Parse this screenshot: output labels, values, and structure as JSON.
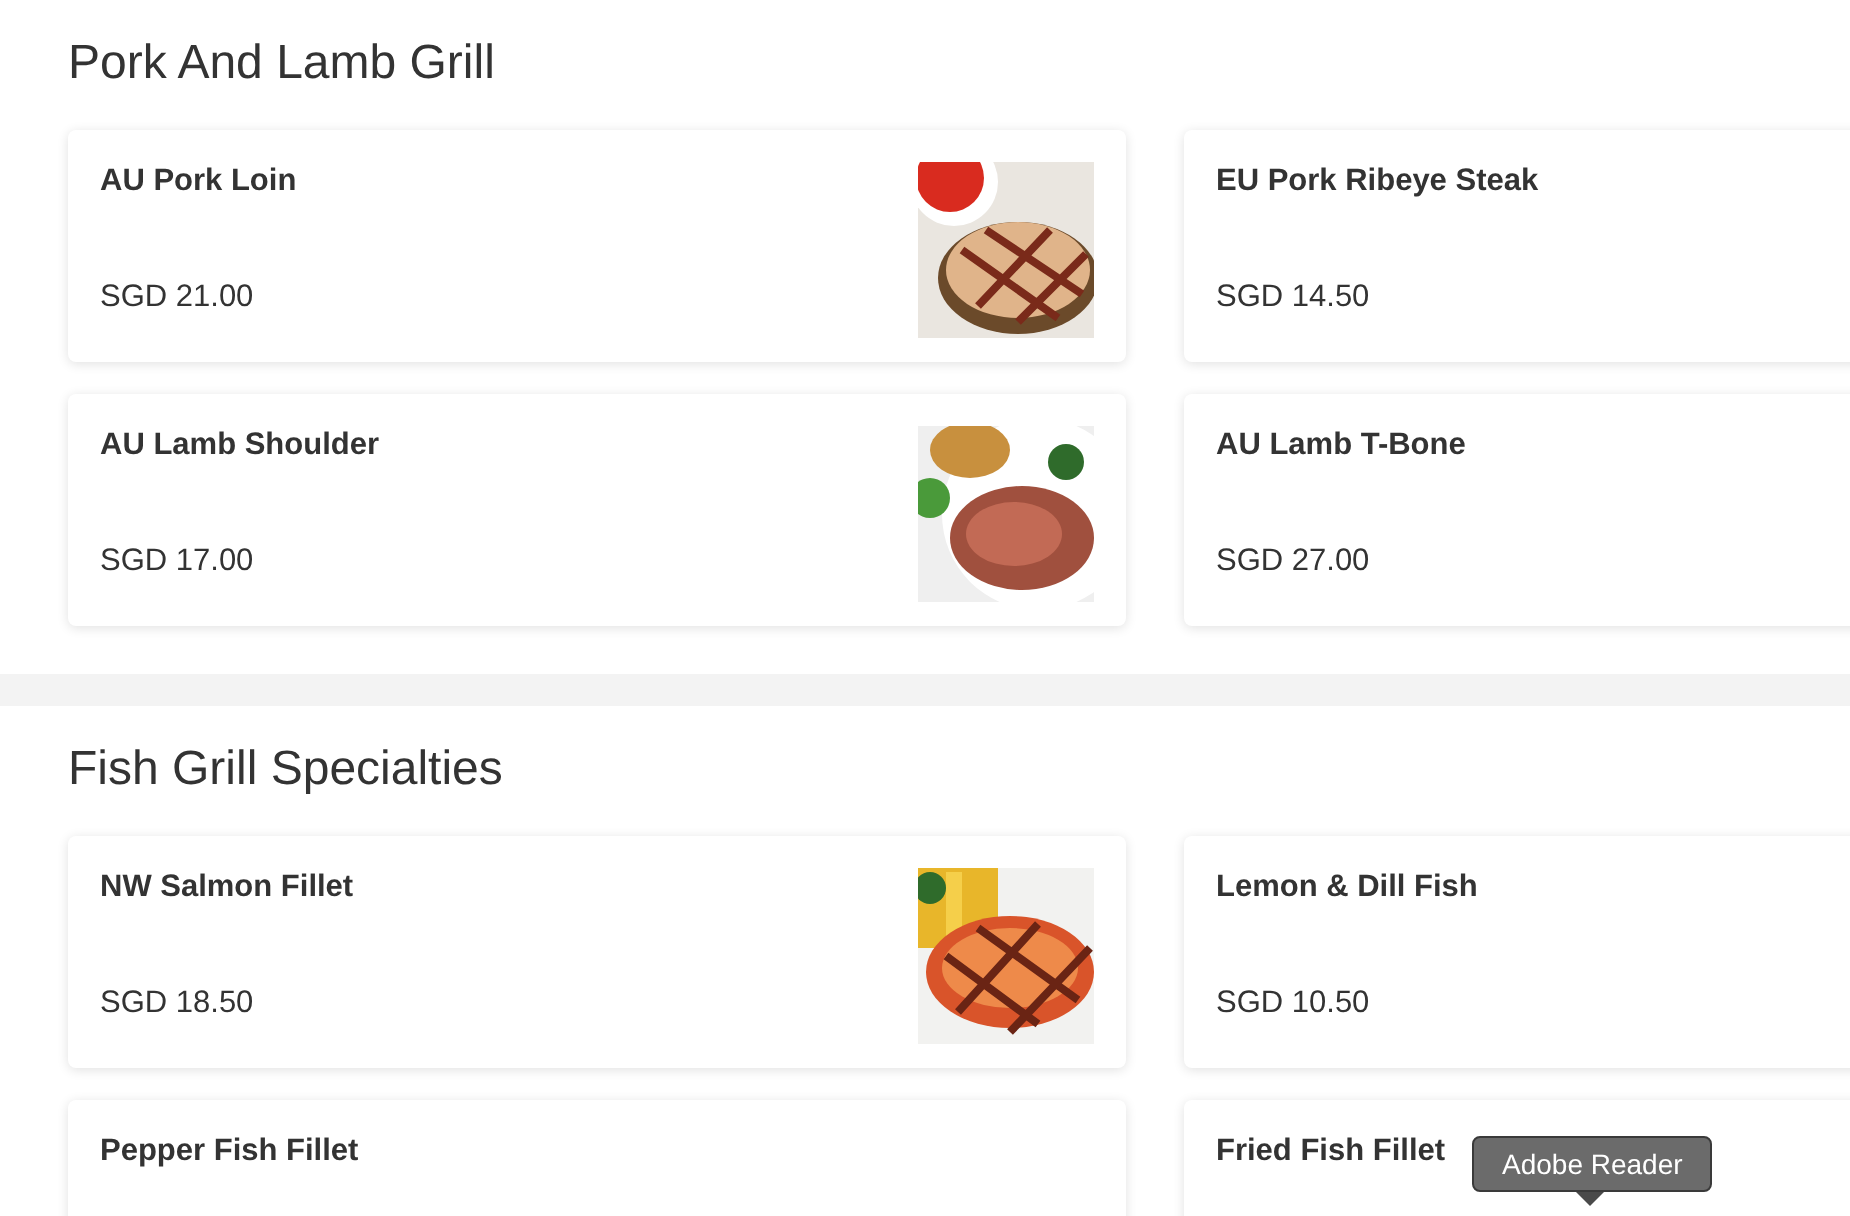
{
  "sections": [
    {
      "title": "Pork And Lamb Grill",
      "items": [
        {
          "name": "AU Pork Loin",
          "price": "SGD 21.00"
        },
        {
          "name": "EU Pork Ribeye Steak",
          "price": "SGD 14.50"
        },
        {
          "name": "AU Lamb Shoulder",
          "price": "SGD 17.00"
        },
        {
          "name": "AU Lamb T-Bone",
          "price": "SGD 27.00"
        }
      ]
    },
    {
      "title": "Fish Grill Specialties",
      "items": [
        {
          "name": "NW Salmon Fillet",
          "price": "SGD 18.50"
        },
        {
          "name": "Lemon & Dill Fish",
          "price": "SGD 10.50"
        },
        {
          "name": "Pepper Fish Fillet"
        },
        {
          "name": "Fried Fish Fillet"
        }
      ]
    }
  ],
  "tooltip": {
    "text": "Adobe Reader"
  }
}
